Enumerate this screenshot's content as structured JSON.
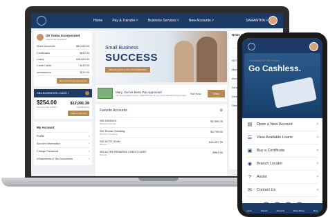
{
  "app": {
    "nav": [
      "Home",
      "Pay & Transfer ˅",
      "Business Services ˅",
      "New Accounts ˅"
    ],
    "user": "SAMANTHA ˅"
  },
  "profile": {
    "name": "Oh Tonka Incorporated",
    "sub": "View Profile & Settings"
  },
  "accounts": [
    {
      "label": "Share Accounts",
      "value": "$51,813.00"
    },
    {
      "label": "Certificates",
      "value": "$810.90"
    },
    {
      "label": "Loans",
      "value": "$16,843.90"
    },
    {
      "label": "Credit Cards",
      "value": "$415.00"
    },
    {
      "label": "Investments",
      "value": "$110.90"
    }
  ],
  "start_button": "Start Full Account Experience",
  "loan": {
    "title": "SBA BUSINESS LOANS ˅",
    "amount": "$254.00",
    "amount_label": "Payment Due 1/15/27",
    "amount2": "$12,091.39",
    "amount2_label": "Total Balance",
    "button": "Make a Payment"
  },
  "my_account": {
    "title": "My Account",
    "items": [
      "Profile",
      "Account Information",
      "Change Password",
      "eStatements & Tax Documents"
    ]
  },
  "hero": {
    "line1": "Small Business",
    "line2": "SUCCESS",
    "button": "CREATE NOTE & ADD ON SOMETHING"
  },
  "approve": {
    "title": "Mary, You've Been Pre Approved!",
    "sub": "You are pre-approved for a $30,000 loan at one of our special business rates.",
    "not_now": "Not Now",
    "view": "View"
  },
  "favorites": {
    "title": "Favorite Accounts",
    "rows": [
      {
        "name": "S50 SAVINGS",
        "sub": "Business Savings",
        "value": "$2,406.29"
      },
      {
        "name": "S51 Ebonic Checking",
        "sub": "Business Checking",
        "value": "$3,799.04"
      },
      {
        "name": "S52 AUTO LOAN",
        "sub": "Balance",
        "value": "$14,007.76"
      },
      {
        "name": "S53 ULTRA REWARDS CREDIT CARD",
        "sub": "Balance",
        "value": "$961.92"
      }
    ]
  },
  "news": {
    "title": "News & Information",
    "side_items": [
      "SET GOALS",
      "Money Mana...",
      "Account Sum...",
      "Schedule Tr...",
      "Scheduled P...",
      "Dividend & I..."
    ]
  },
  "phone": {
    "banner_sub": "The Wallet Of The Future.",
    "banner_title": "Go Cashless.",
    "menu": [
      {
        "icon": "open-account-icon",
        "glyph": "▤",
        "label": "Open a New Account"
      },
      {
        "icon": "loans-icon",
        "glyph": "☰",
        "label": "View Available Loans"
      },
      {
        "icon": "certificate-icon",
        "glyph": "▣",
        "label": "Buy a Certificate"
      },
      {
        "icon": "location-icon",
        "glyph": "◉",
        "label": "Branch Locator"
      },
      {
        "icon": "help-icon",
        "glyph": "?",
        "label": "Assist"
      },
      {
        "icon": "contact-icon",
        "glyph": "✉",
        "label": "Contact Us"
      }
    ],
    "tabs": [
      "Home",
      "Deposit",
      "Accounts",
      "Move Money",
      "More"
    ]
  },
  "colors": {
    "navy": "#1c3a66",
    "gold": "#b38a55"
  }
}
